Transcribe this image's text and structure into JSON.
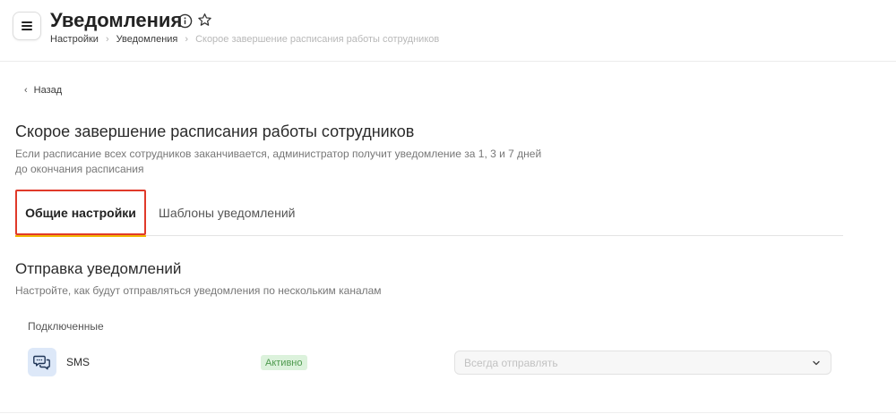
{
  "header": {
    "title": "Уведомления",
    "breadcrumb": [
      "Настройки",
      "Уведомления",
      "Скорое завершение расписания работы сотрудников"
    ]
  },
  "back": {
    "label": "Назад"
  },
  "section": {
    "title": "Скорое завершение расписания работы сотрудников",
    "description": "Если расписание всех сотрудников заканчивается, администратор получит уведомление за 1, 3 и 7 дней до окончания расписания"
  },
  "tabs": [
    {
      "label": "Общие настройки",
      "active": true
    },
    {
      "label": "Шаблоны уведомлений",
      "active": false
    }
  ],
  "sending": {
    "title": "Отправка уведомлений",
    "description": "Настройте, как будут отправляться уведомления по нескольким каналам",
    "connected_label": "Подключенные",
    "channels": [
      {
        "name": "SMS",
        "icon": "chat-bubbles-icon",
        "status": "Активно",
        "select_value": "Всегда отправлять"
      }
    ]
  },
  "colors": {
    "accent_outline": "#e03a2a",
    "tab_underline": "#f2b705",
    "status_bg": "#dcf2dc",
    "status_text": "#4e9a4e",
    "icon_bg": "#dde8f8"
  }
}
